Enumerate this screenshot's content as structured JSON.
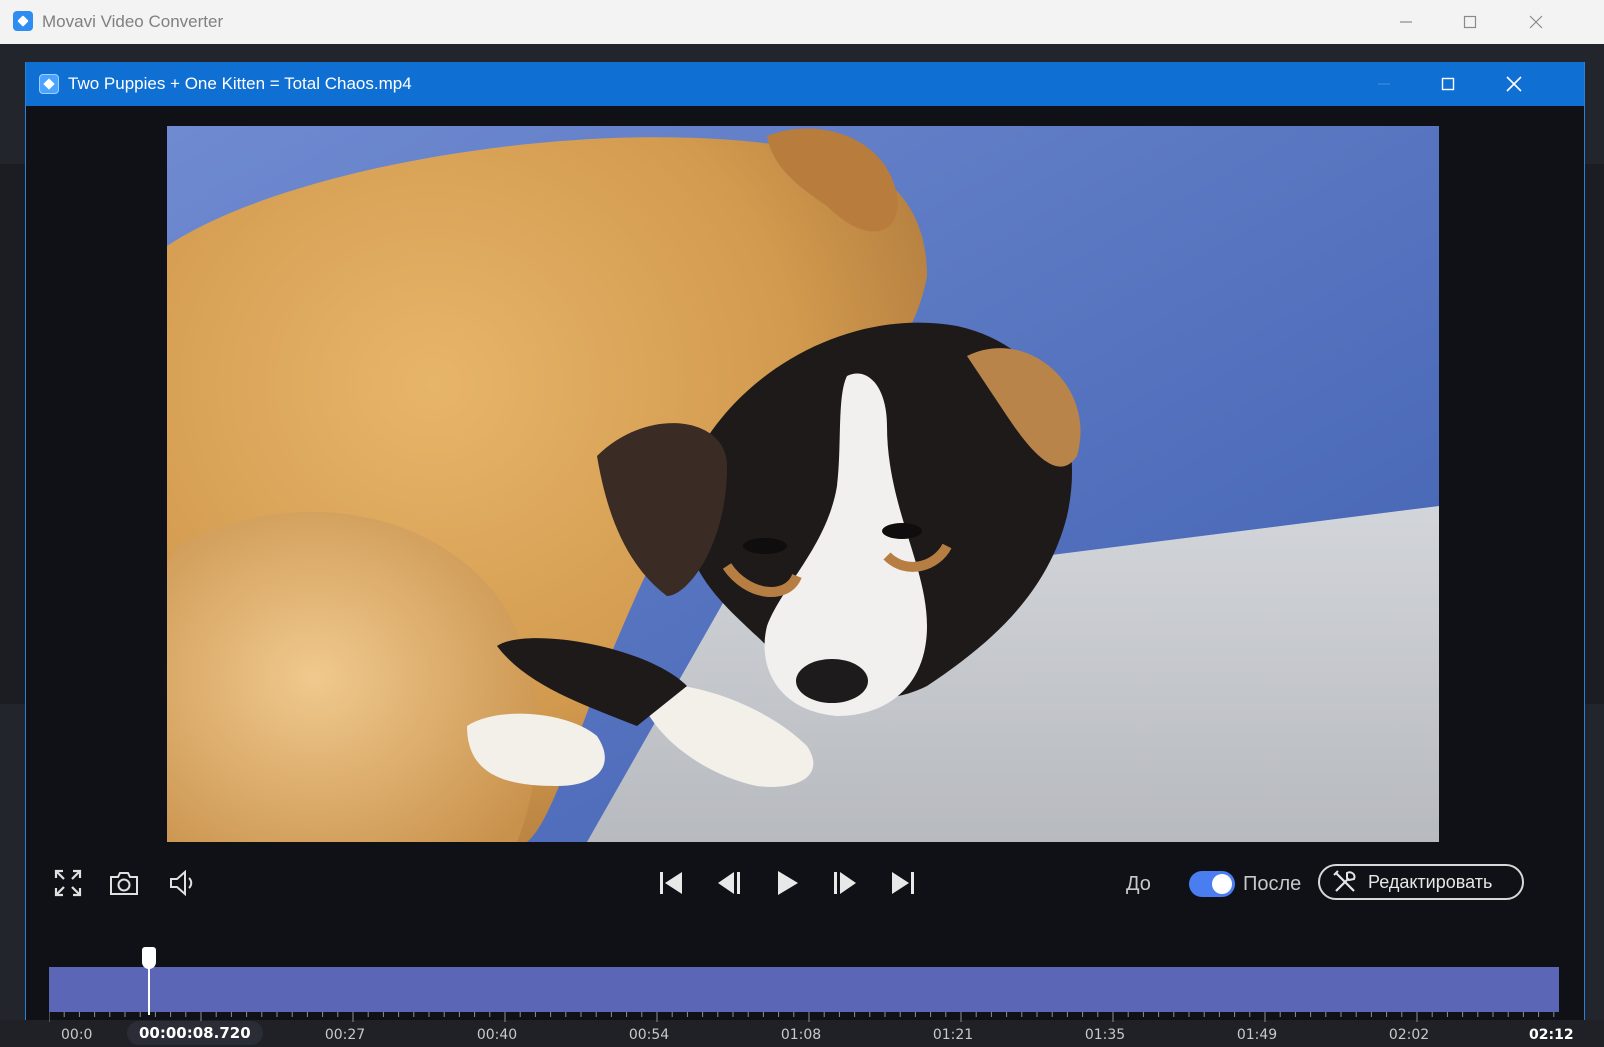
{
  "app": {
    "title": "Movavi Video Converter"
  },
  "player": {
    "title": "Two Puppies + One Kitten = Total Chaos.mp4"
  },
  "controls": {
    "before_label": "До",
    "after_label": "После",
    "edit_label": "Редактировать",
    "toggle_on": true
  },
  "timeline": {
    "current_time": "00:00:08.720",
    "start_label": "00:0",
    "end_label": "02:12",
    "progress": 0.066,
    "tick_labels": [
      "00:27",
      "00:40",
      "00:54",
      "01:08",
      "01:21",
      "01:35",
      "01:49",
      "02:02"
    ]
  },
  "colors": {
    "accent": "#0f6fd3",
    "track": "#5b66b6",
    "toggle": "#4a7ef0"
  },
  "icons": {
    "fullscreen": "fullscreen-icon",
    "snapshot": "camera-icon",
    "volume": "volume-icon",
    "go_start": "skip-start-icon",
    "prev_frame": "prev-frame-icon",
    "play": "play-icon",
    "next_frame": "next-frame-icon",
    "go_end": "skip-end-icon",
    "edit": "tools-icon"
  }
}
